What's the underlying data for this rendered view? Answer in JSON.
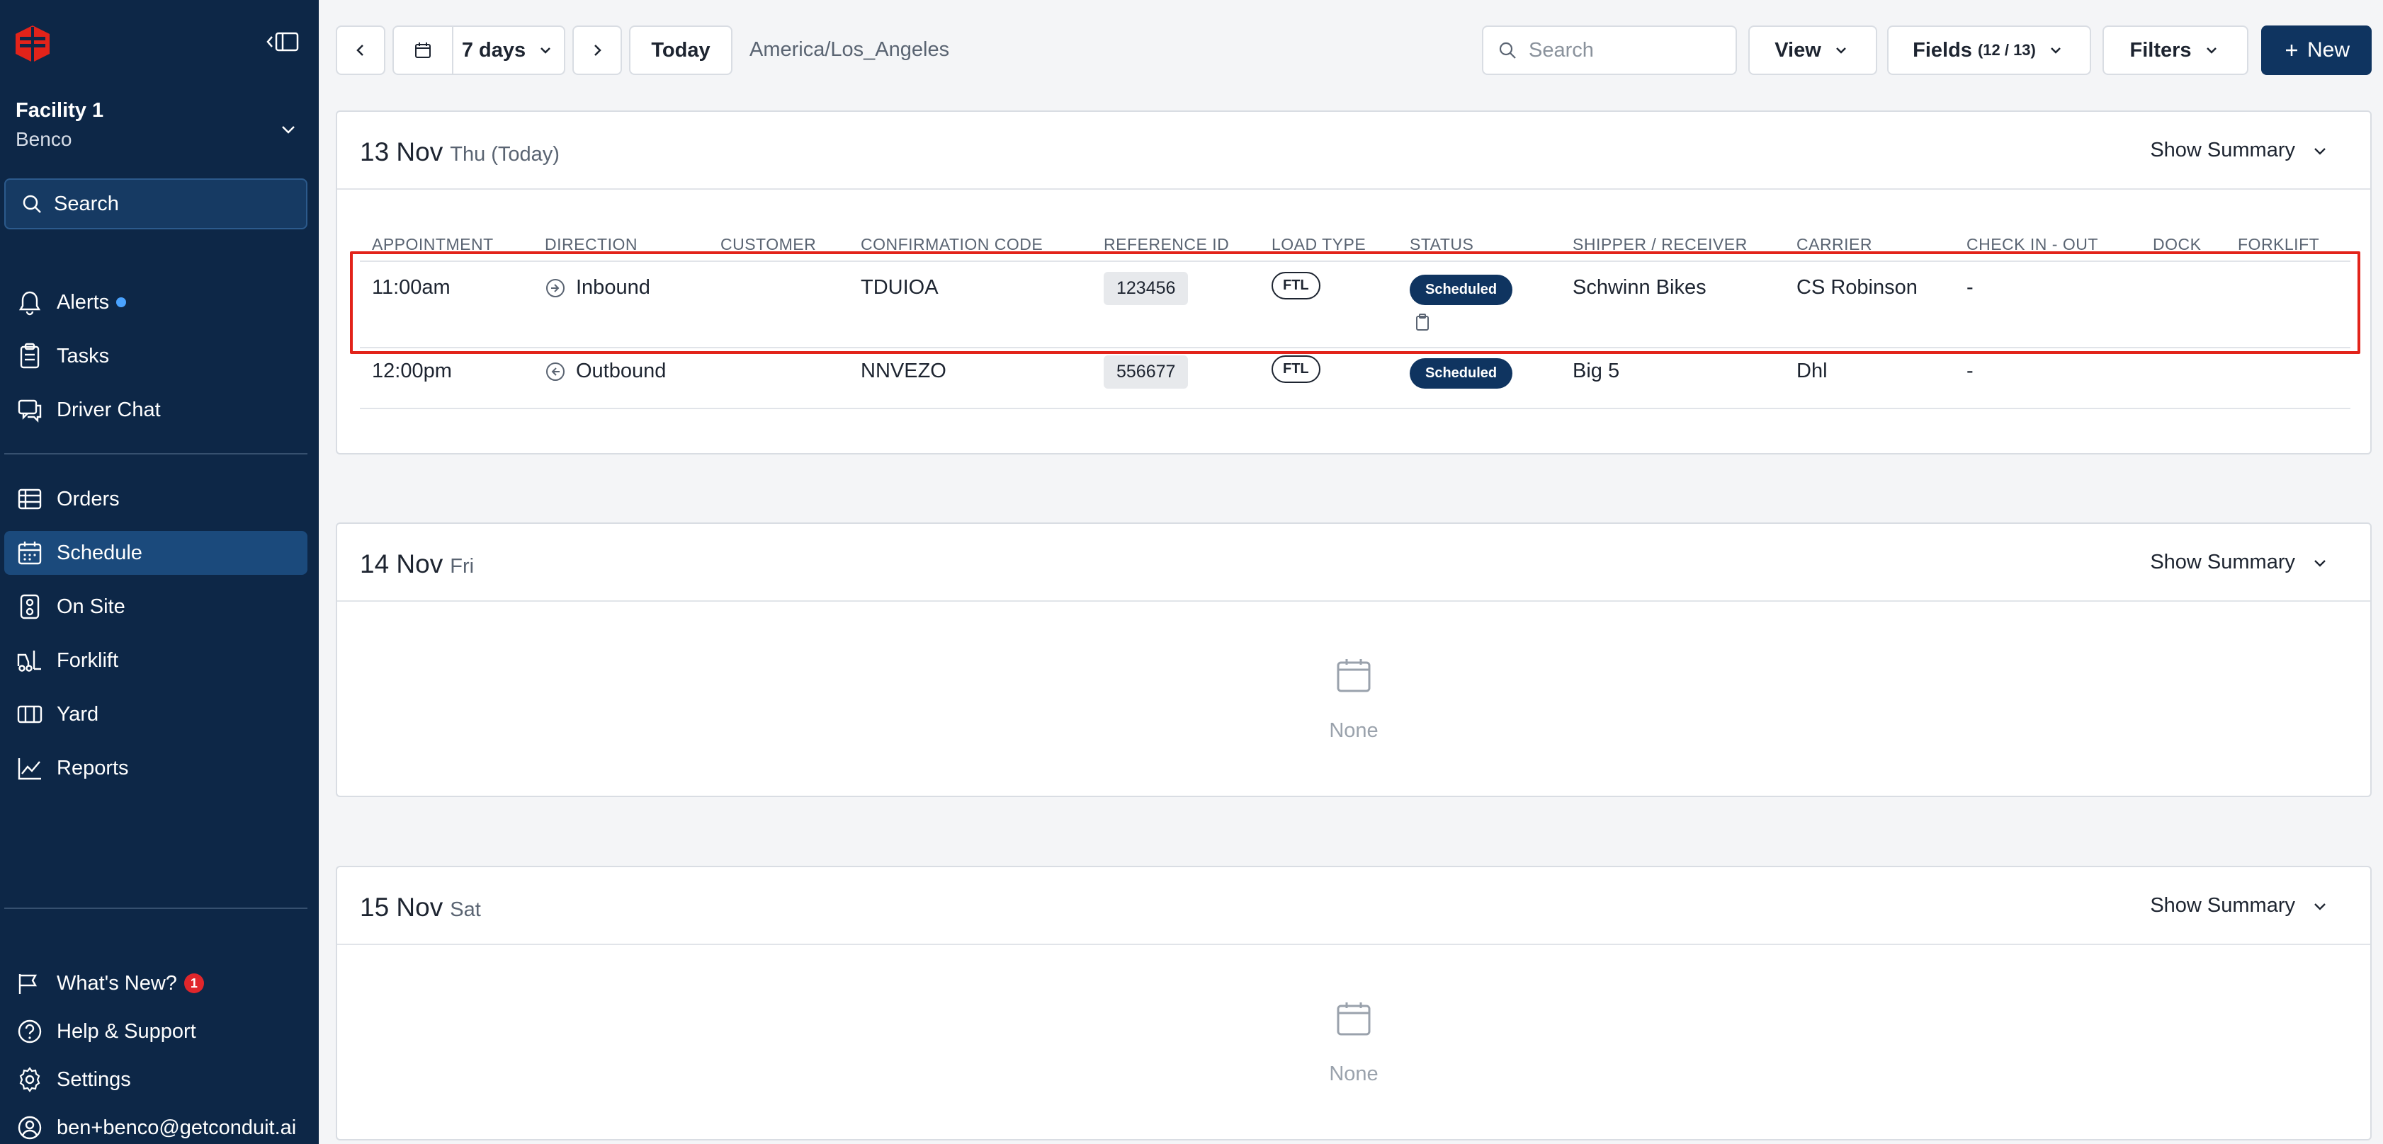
{
  "app": {
    "brand_color": "#0d2747",
    "accent_color": "#0f3460",
    "highlight_color": "#e2231a"
  },
  "sidebar": {
    "facility": {
      "name": "Facility 1",
      "org": "Benco"
    },
    "search_label": "Search",
    "items_top": [
      {
        "label": "Alerts",
        "icon": "bell-icon"
      },
      {
        "label": "Tasks",
        "icon": "clipboard-icon"
      },
      {
        "label": "Driver Chat",
        "icon": "chat-icon"
      }
    ],
    "items_main": [
      {
        "label": "Orders",
        "icon": "orders-icon"
      },
      {
        "label": "Schedule",
        "icon": "calendar-icon",
        "active": true
      },
      {
        "label": "On Site",
        "icon": "onsite-icon"
      },
      {
        "label": "Forklift",
        "icon": "forklift-icon"
      },
      {
        "label": "Yard",
        "icon": "yard-icon"
      },
      {
        "label": "Reports",
        "icon": "chart-icon"
      }
    ],
    "items_bottom": [
      {
        "label": "What's New?",
        "icon": "megaphone-icon",
        "badge": "1"
      },
      {
        "label": "Help & Support",
        "icon": "help-icon"
      },
      {
        "label": "Settings",
        "icon": "gear-icon"
      },
      {
        "label": "ben+benco@getconduit.ai",
        "icon": "user-icon"
      }
    ]
  },
  "toolbar": {
    "range_label": "7 days",
    "today_label": "Today",
    "timezone": "America/Los_Angeles",
    "search_placeholder": "Search",
    "view_label": "View",
    "fields_label": "Fields",
    "fields_count": "(12 / 13)",
    "filters_label": "Filters",
    "new_label": "New"
  },
  "columns": [
    "APPOINTMENT",
    "DIRECTION",
    "CUSTOMER",
    "CONFIRMATION CODE",
    "REFERENCE ID",
    "LOAD TYPE",
    "STATUS",
    "SHIPPER / RECEIVER",
    "CARRIER",
    "CHECK IN - OUT",
    "DOCK",
    "FORKLIFT"
  ],
  "days": [
    {
      "date": "13 Nov",
      "weekday": "Thu (Today)",
      "summary_label": "Show Summary",
      "rows": [
        {
          "time": "11:00am",
          "direction": "Inbound",
          "customer": "",
          "confirmation": "TDUIOA",
          "reference": "123456",
          "load_type": "FTL",
          "status": "Scheduled",
          "shipper": "Schwinn Bikes",
          "carrier": "CS Robinson",
          "check": "-"
        },
        {
          "time": "12:00pm",
          "direction": "Outbound",
          "customer": "",
          "confirmation": "NNVEZO",
          "reference": "556677",
          "load_type": "FTL",
          "status": "Scheduled",
          "shipper": "Big 5",
          "carrier": "Dhl",
          "check": "-"
        }
      ]
    },
    {
      "date": "14 Nov",
      "weekday": "Fri",
      "summary_label": "Show Summary",
      "empty_label": "None"
    },
    {
      "date": "15 Nov",
      "weekday": "Sat",
      "summary_label": "Show Summary",
      "empty_label": "None"
    }
  ]
}
